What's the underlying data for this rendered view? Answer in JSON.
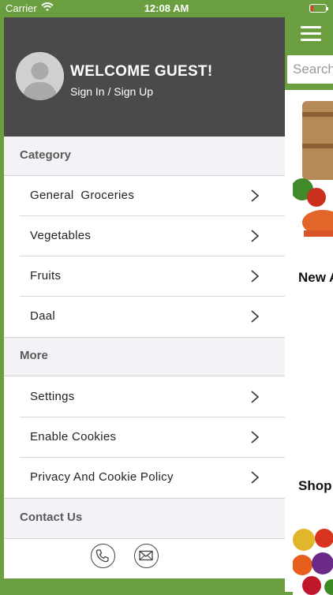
{
  "status_bar": {
    "carrier": "Carrier",
    "time": "12:08 AM"
  },
  "drawer": {
    "welcome": "WELCOME GUEST!",
    "signin": "Sign In / Sign Up",
    "category_header": "Category",
    "categories": [
      {
        "label": "General  Groceries"
      },
      {
        "label": "Vegetables"
      },
      {
        "label": "Fruits"
      },
      {
        "label": "Daal"
      }
    ],
    "more_header": "More",
    "more_items": [
      {
        "label": "Settings"
      },
      {
        "label": "Enable Cookies"
      },
      {
        "label": "Privacy And Cookie Policy"
      }
    ],
    "contact_header": "Contact Us",
    "contact_icons": [
      "phone-icon",
      "mail-icon"
    ]
  },
  "background": {
    "search_placeholder": "Search",
    "label_new": "New A",
    "label_shop": "Shop"
  },
  "colors": {
    "brand_green": "#6a9e3e",
    "header_dark": "#4a4a4a",
    "section_bg": "#f5f2f7"
  }
}
